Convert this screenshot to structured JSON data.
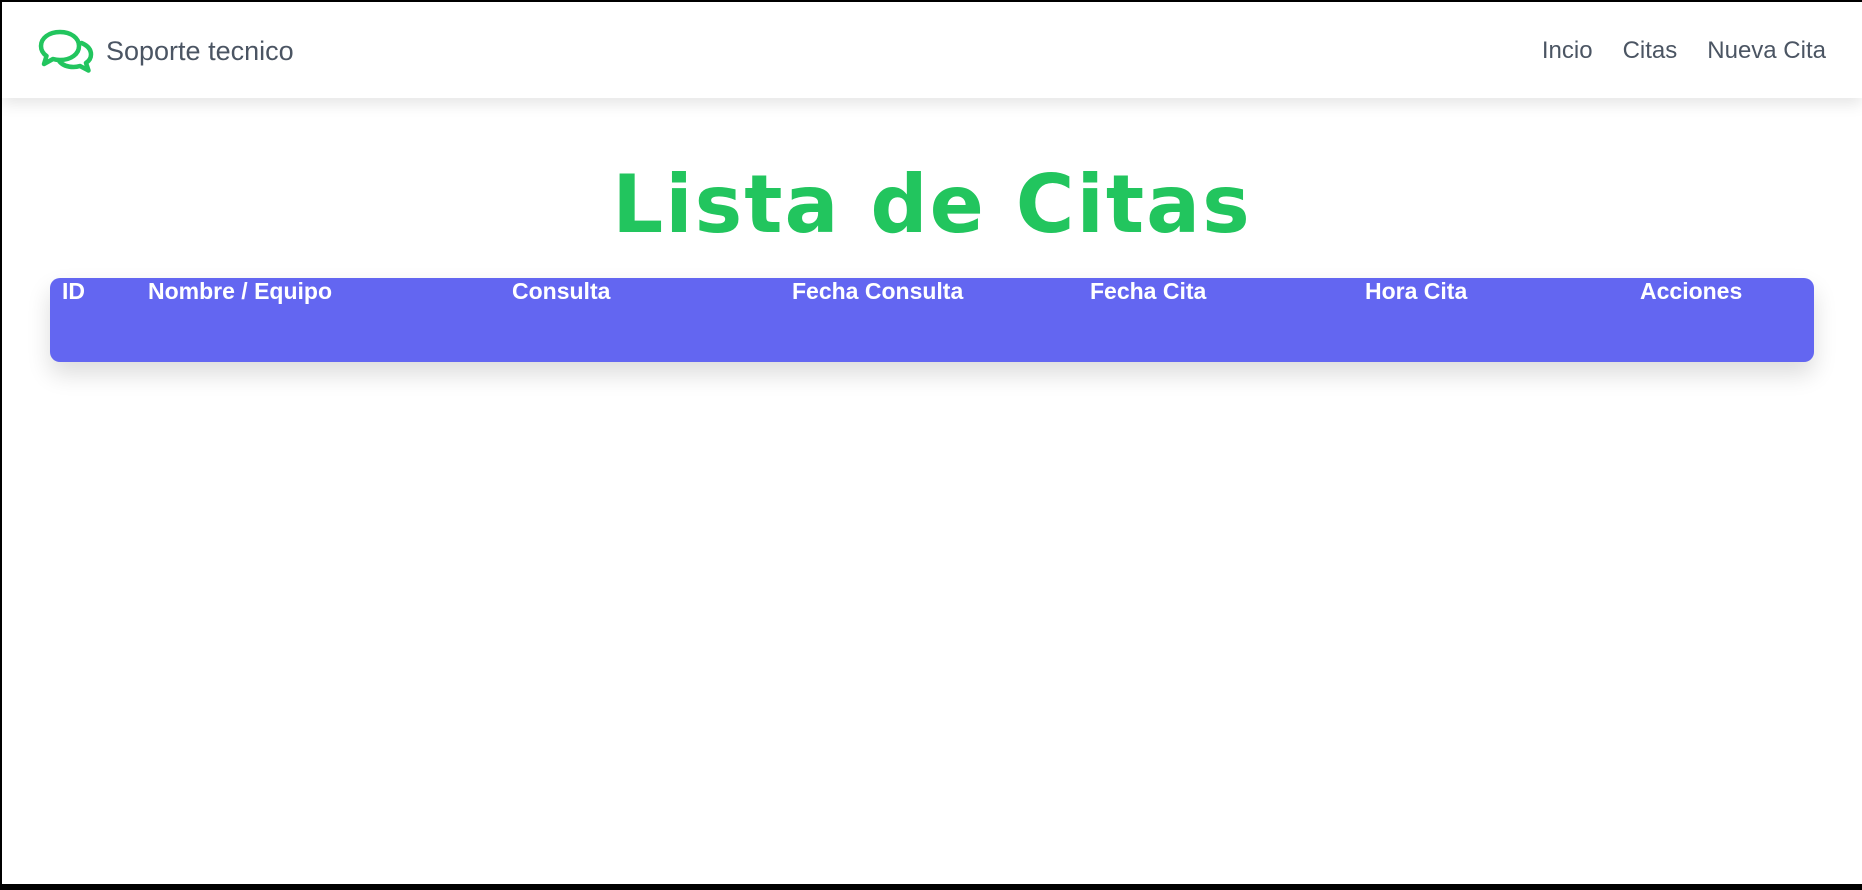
{
  "navbar": {
    "brand_icon": "chat-bubbles-icon",
    "brand_name": "Soporte tecnico",
    "links": [
      {
        "label": "Incio"
      },
      {
        "label": "Citas"
      },
      {
        "label": "Nueva Cita"
      }
    ]
  },
  "main": {
    "title": "Lista de Citas",
    "table": {
      "columns": [
        "ID",
        "Nombre / Equipo",
        "Consulta",
        "Fecha Consulta",
        "Fecha Cita",
        "Hora Cita",
        "Acciones"
      ],
      "rows": []
    }
  },
  "colors": {
    "accent_green": "#22c55e",
    "table_header_bg": "#6366f1",
    "nav_text": "#4b5563"
  }
}
